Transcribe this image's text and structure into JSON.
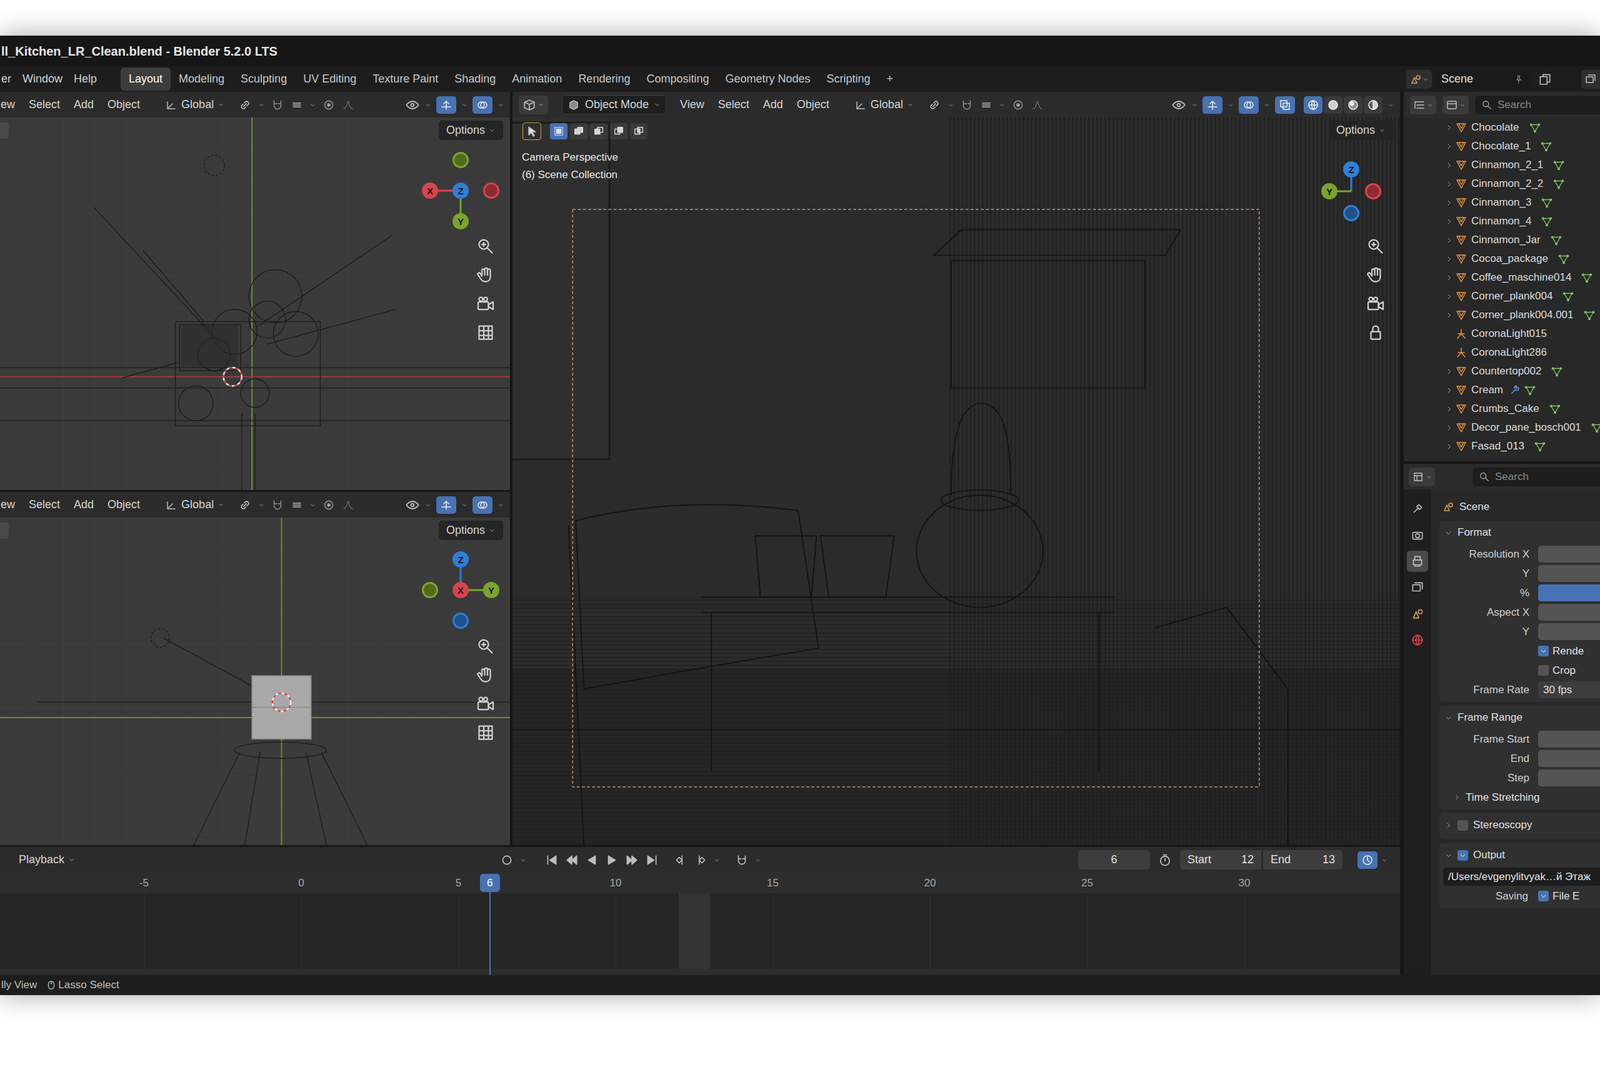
{
  "window": {
    "title": "ll_Kitchen_LR_Clean.blend - Blender 5.2.0 LTS"
  },
  "menu": [
    "er",
    "Window",
    "Help"
  ],
  "workspaces": [
    {
      "label": "Layout",
      "selected": true
    },
    {
      "label": "Modeling",
      "selected": false
    },
    {
      "label": "Sculpting",
      "selected": false
    },
    {
      "label": "UV Editing",
      "selected": false
    },
    {
      "label": "Texture Paint",
      "selected": false
    },
    {
      "label": "Shading",
      "selected": false
    },
    {
      "label": "Animation",
      "selected": false
    },
    {
      "label": "Rendering",
      "selected": false
    },
    {
      "label": "Compositing",
      "selected": false
    },
    {
      "label": "Geometry Nodes",
      "selected": false
    },
    {
      "label": "Scripting",
      "selected": false
    }
  ],
  "add_workspace": "+",
  "scene": {
    "name": "Scene"
  },
  "side_viewports": [
    {
      "menu": [
        "ew",
        "Select",
        "Add",
        "Object"
      ],
      "orientation": "Global",
      "options": "Options",
      "toggles": [
        {
          "on": true
        },
        {
          "on": true
        }
      ],
      "gizmo": [
        {
          "kind": "negative",
          "color": "#7aa52c",
          "direction": "up"
        },
        {
          "kind": "negative",
          "color": "#d8434d",
          "direction": "right"
        },
        {
          "kind": "positive",
          "label": "X",
          "color": "#d8434d",
          "direction": "left"
        },
        {
          "kind": "positive",
          "label": "Y",
          "color": "#7aa52c",
          "direction": "down"
        },
        {
          "kind": "positive",
          "label": "Z",
          "color": "#2f7fd8",
          "direction": "center"
        }
      ]
    },
    {
      "menu": [
        "ew",
        "Select",
        "Add",
        "Object"
      ],
      "orientation": "Global",
      "options": "Options",
      "toggles": [
        {
          "on": true
        },
        {
          "on": true
        }
      ],
      "gizmo": [
        {
          "kind": "negative",
          "color": "#7aa52c",
          "direction": "left"
        },
        {
          "kind": "negative",
          "color": "#2f7fd8",
          "direction": "down"
        },
        {
          "kind": "positive",
          "label": "Z",
          "color": "#2f7fd8",
          "direction": "up"
        },
        {
          "kind": "positive",
          "label": "Y",
          "color": "#7aa52c",
          "direction": "right"
        },
        {
          "kind": "positive",
          "label": "X",
          "color": "#d8434d",
          "direction": "center"
        }
      ]
    }
  ],
  "camera_viewport": {
    "mode": "Object Mode",
    "menu": [
      "View",
      "Select",
      "Add",
      "Object"
    ],
    "orientation": "Global",
    "options": "Options",
    "toggles": [
      {
        "on": true
      },
      {
        "on": true
      },
      {
        "on": true
      }
    ],
    "shading": [
      {
        "selected": true
      },
      {
        "selected": false
      },
      {
        "selected": false
      },
      {
        "selected": false
      }
    ],
    "select_modes": [
      {
        "selected": true
      },
      {
        "selected": false
      },
      {
        "selected": false
      },
      {
        "selected": false
      },
      {
        "selected": false
      }
    ],
    "overlay": [
      "Camera Perspective",
      "(6) Scene Collection"
    ],
    "gizmo": [
      {
        "kind": "negative",
        "color": "#d8434d",
        "direction": "right"
      },
      {
        "kind": "negative",
        "color": "#2f7fd8",
        "direction": "down"
      },
      {
        "kind": "positive",
        "label": "Z",
        "color": "#2f7fd8",
        "direction": "up"
      },
      {
        "kind": "positive",
        "label": "Y",
        "color": "#7aa52c",
        "direction": "left"
      }
    ]
  },
  "outliner": {
    "search": "Search",
    "items": [
      {
        "name": "Chocolate",
        "kind": "mesh",
        "expandable": true,
        "modifier": false
      },
      {
        "name": "Chocolate_1",
        "kind": "mesh",
        "expandable": true,
        "modifier": false
      },
      {
        "name": "Cinnamon_2_1",
        "kind": "mesh",
        "expandable": true,
        "modifier": false
      },
      {
        "name": "Cinnamon_2_2",
        "kind": "mesh",
        "expandable": true,
        "modifier": false
      },
      {
        "name": "Cinnamon_3",
        "kind": "mesh",
        "expandable": true,
        "modifier": false
      },
      {
        "name": "Cinnamon_4",
        "kind": "mesh",
        "expandable": true,
        "modifier": false
      },
      {
        "name": "Cinnamon_Jar",
        "kind": "mesh",
        "expandable": true,
        "modifier": false
      },
      {
        "name": "Cocoa_package",
        "kind": "mesh",
        "expandable": true,
        "modifier": false
      },
      {
        "name": "Coffee_maschine014",
        "kind": "mesh",
        "expandable": true,
        "modifier": false
      },
      {
        "name": "Corner_plank004",
        "kind": "mesh",
        "expandable": true,
        "modifier": false
      },
      {
        "name": "Corner_plank004.001",
        "kind": "mesh",
        "expandable": true,
        "modifier": false
      },
      {
        "name": "CoronaLight015",
        "kind": "light",
        "expandable": false,
        "modifier": false
      },
      {
        "name": "CoronaLight286",
        "kind": "light",
        "expandable": false,
        "modifier": false
      },
      {
        "name": "Countertop002",
        "kind": "mesh",
        "expandable": true,
        "modifier": false
      },
      {
        "name": "Cream",
        "kind": "mesh",
        "expandable": true,
        "modifier": true
      },
      {
        "name": "Crumbs_Cake",
        "kind": "mesh",
        "expandable": true,
        "modifier": false
      },
      {
        "name": "Decor_pane_bosch001",
        "kind": "mesh",
        "expandable": true,
        "modifier": false
      },
      {
        "name": "Fasad_013",
        "kind": "mesh",
        "expandable": true,
        "modifier": false
      }
    ]
  },
  "properties": {
    "search": "Search",
    "tabs": [
      {
        "selected": false
      },
      {
        "selected": false
      },
      {
        "selected": true
      },
      {
        "selected": false
      },
      {
        "selected": false
      },
      {
        "selected": false
      }
    ],
    "context": "Scene",
    "panels": [
      {
        "title": "Format",
        "expanded": true,
        "rows": [
          {
            "kind": "field",
            "label": "Resolution X"
          },
          {
            "kind": "field",
            "label": "Y"
          },
          {
            "kind": "slider",
            "label": "%",
            "level": 1
          },
          {
            "kind": "field",
            "label": "Aspect X"
          },
          {
            "kind": "field",
            "label": "Y"
          },
          {
            "kind": "checkbox",
            "label": "Rende",
            "checked": true
          },
          {
            "kind": "checkbox",
            "label": "Crop",
            "checked": false
          },
          {
            "kind": "field",
            "label": "Frame Rate",
            "value": "30 fps"
          }
        ]
      },
      {
        "title": "Frame Range",
        "expanded": true,
        "rows": [
          {
            "kind": "field",
            "label": "Frame Start"
          },
          {
            "kind": "field",
            "label": "End"
          },
          {
            "kind": "field",
            "label": "Step"
          },
          {
            "kind": "subpanel",
            "label": "Time Stretching",
            "expanded": false
          }
        ]
      },
      {
        "title": "Stereoscopy",
        "expanded": false,
        "toggle": false
      },
      {
        "title": "Output",
        "expanded": true,
        "toggle": true,
        "rows": [
          {
            "kind": "path",
            "value": "/Users/evgenylitvyak…й Этаж"
          },
          {
            "kind": "checkbox",
            "caption": "Saving",
            "label": "File E",
            "checked": true
          }
        ]
      }
    ]
  },
  "timeline": {
    "mode": "Playback",
    "current_frame": "6",
    "start_label": "Start",
    "start": "12",
    "end_label": "End",
    "end": "13",
    "ticks": [
      "-5",
      "0",
      "5",
      "10",
      "15",
      "20",
      "25",
      "30"
    ],
    "playhead": "6"
  },
  "status_bar": [
    "lly View",
    "Lasso Select"
  ]
}
